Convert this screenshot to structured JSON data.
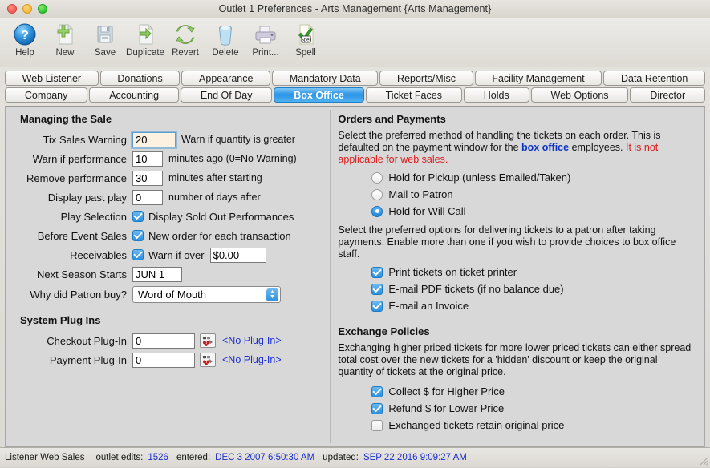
{
  "window": {
    "title": "Outlet 1 Preferences - Arts Management {Arts Management}"
  },
  "toolbar": {
    "buttons": [
      {
        "label": "Help",
        "icon": "help-icon"
      },
      {
        "label": "New",
        "icon": "new-document-icon"
      },
      {
        "label": "Save",
        "icon": "save-floppy-icon"
      },
      {
        "label": "Duplicate",
        "icon": "duplicate-icon"
      },
      {
        "label": "Revert",
        "icon": "revert-refresh-icon"
      },
      {
        "label": "Delete",
        "icon": "trash-icon"
      },
      {
        "label": "Print...",
        "icon": "printer-icon"
      },
      {
        "label": "Spell",
        "icon": "spellcheck-icon"
      }
    ]
  },
  "tabs": {
    "row1": [
      {
        "label": "Web Listener",
        "active": false
      },
      {
        "label": "Donations",
        "active": false
      },
      {
        "label": "Appearance",
        "active": false
      },
      {
        "label": "Mandatory Data",
        "active": false
      },
      {
        "label": "Reports/Misc",
        "active": false
      },
      {
        "label": "Facility Management",
        "active": false
      },
      {
        "label": "Data Retention",
        "active": false
      }
    ],
    "row2": [
      {
        "label": "Company",
        "active": false
      },
      {
        "label": "Accounting",
        "active": false
      },
      {
        "label": "End Of Day",
        "active": false
      },
      {
        "label": "Box Office",
        "active": true
      },
      {
        "label": "Ticket Faces",
        "active": false
      },
      {
        "label": "Holds",
        "active": false
      },
      {
        "label": "Web Options",
        "active": false
      },
      {
        "label": "Director",
        "active": false
      }
    ]
  },
  "managing_the_sale": {
    "heading": "Managing the Sale",
    "tix_sales_warning": {
      "label": "Tix Sales Warning",
      "value": "20",
      "note": "Warn if quantity is greater"
    },
    "warn_if_performance": {
      "label": "Warn if performance",
      "value": "10",
      "note": "minutes ago (0=No Warning)"
    },
    "remove_performance": {
      "label": "Remove performance",
      "value": "30",
      "note": "minutes after starting"
    },
    "display_past_play": {
      "label": "Display past play",
      "value": "0",
      "note": "number of days after"
    },
    "play_selection": {
      "label": "Play Selection",
      "checkbox_label": "Display Sold Out Performances",
      "checked": true
    },
    "before_event_sales": {
      "label": "Before Event Sales",
      "checkbox_label": "New order for each transaction",
      "checked": true
    },
    "receivables": {
      "label": "Receivables",
      "checkbox_label": "Warn if over",
      "checked": true,
      "amount": "$0.00"
    },
    "next_season_starts": {
      "label": "Next Season Starts",
      "value": "JUN 1"
    },
    "why_did_patron_buy": {
      "label": "Why did Patron buy?",
      "value": "Word of Mouth"
    }
  },
  "system_plug_ins": {
    "heading": "System Plug Ins",
    "checkout": {
      "label": "Checkout Plug-In",
      "value": "0",
      "status": "<No Plug-In>"
    },
    "payment": {
      "label": "Payment Plug-In",
      "value": "0",
      "status": "<No Plug-In>"
    }
  },
  "orders_and_payments": {
    "heading": "Orders and Payments",
    "description_part1": "Select the preferred method of handling the tickets on each order.  This is defaulted on the payment window for the ",
    "description_blue": "box office",
    "description_part2": " employees.  ",
    "description_red": "It is not applicable for web sales.",
    "radio_options": [
      {
        "label": "Hold for Pickup (unless Emailed/Taken)",
        "selected": false
      },
      {
        "label": "Mail to Patron",
        "selected": false
      },
      {
        "label": "Hold for Will Call",
        "selected": true
      }
    ],
    "delivery_description": "Select the preferred options for delivering tickets to a patron after taking payments.  Enable more than one if you wish to provide choices to box office staff.",
    "delivery_options": [
      {
        "label": "Print tickets on ticket printer",
        "checked": true
      },
      {
        "label": "E-mail PDF tickets (if no balance due)",
        "checked": true
      },
      {
        "label": "E-mail an Invoice",
        "checked": true
      }
    ]
  },
  "exchange_policies": {
    "heading": "Exchange Policies",
    "description": "Exchanging higher priced tickets for more lower priced tickets can either spread total cost over the new tickets for a 'hidden' discount or keep the original quantity of tickets at the original price.",
    "options": [
      {
        "label": "Collect $ for Higher Price",
        "checked": true
      },
      {
        "label": "Refund $ for Lower Price",
        "checked": true
      },
      {
        "label": "Exchanged tickets retain original price",
        "checked": false
      }
    ]
  },
  "statusbar": {
    "window_name": "Listener Web Sales",
    "edits_label": "outlet edits:",
    "edits_value": "1526",
    "entered_label": "entered:",
    "entered_value": "DEC 3 2007 6:50:30 AM",
    "updated_label": "updated:",
    "updated_value": "SEP 22 2016 9:09:27 AM"
  },
  "colors": {
    "accent_blue": "#2a93e6",
    "link_blue": "#1c2fd0",
    "warning_red": "#e01b1b",
    "panel_gray": "#d8d8d8"
  }
}
